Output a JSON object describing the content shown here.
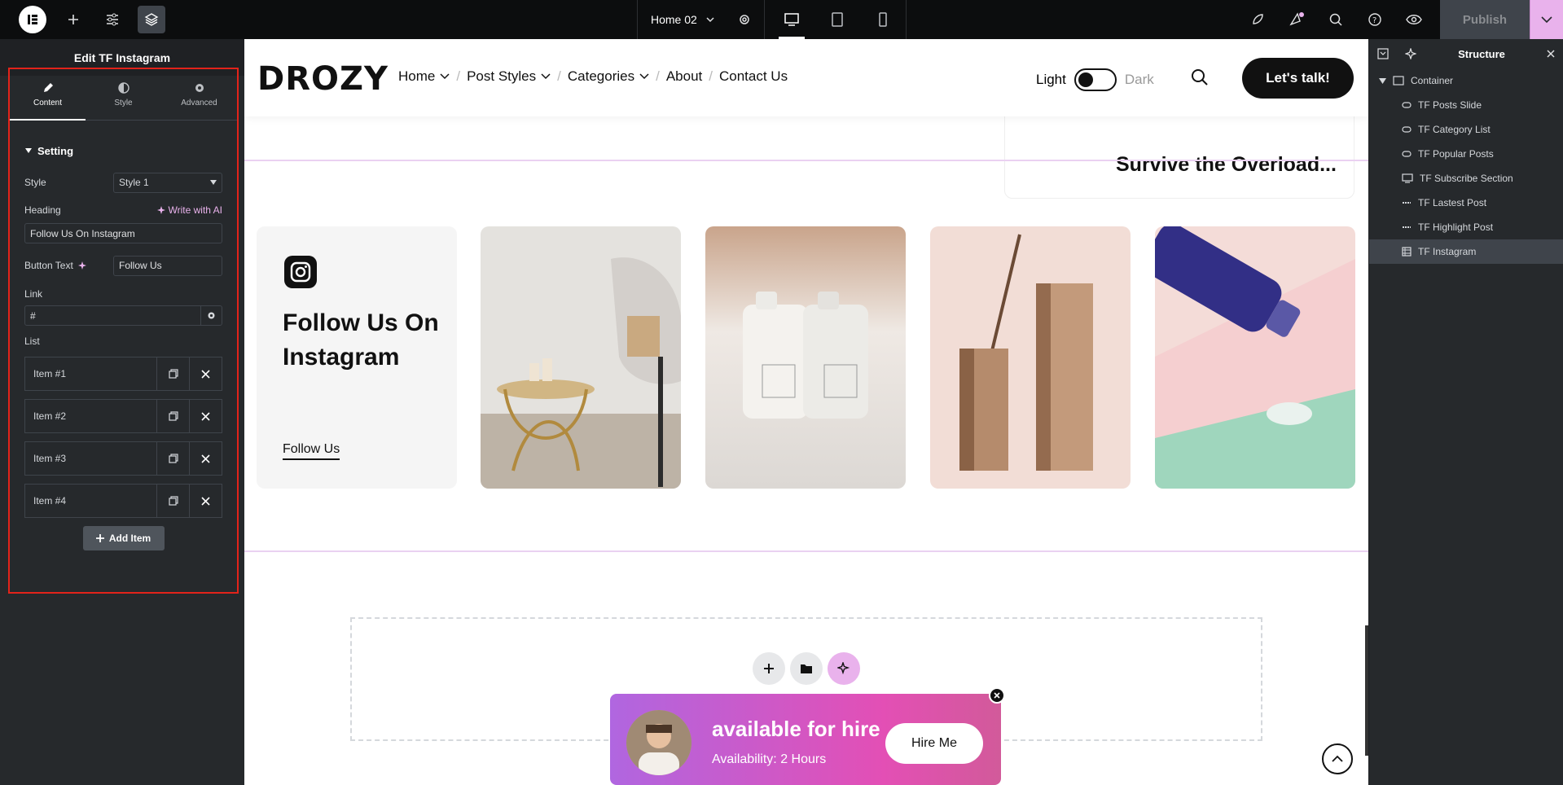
{
  "topbar": {
    "page_name": "Home 02",
    "publish_label": "Publish"
  },
  "panel": {
    "title": "Edit TF Instagram",
    "tabs": [
      {
        "label": "Content"
      },
      {
        "label": "Style"
      },
      {
        "label": "Advanced"
      }
    ],
    "section_title": "Setting",
    "style_label": "Style",
    "style_value": "Style 1",
    "heading_label": "Heading",
    "write_ai_label": "Write with AI",
    "heading_value": "Follow Us On Instagram",
    "button_text_label": "Button Text",
    "button_text_value": "Follow Us",
    "link_label": "Link",
    "link_value": "#",
    "list_label": "List",
    "list_items": [
      "Item #1",
      "Item #2",
      "Item #3",
      "Item #4"
    ],
    "add_item_label": "Add Item"
  },
  "site": {
    "brand": "DROZY",
    "nav": [
      "Home",
      "Post Styles",
      "Categories",
      "About",
      "Contact Us"
    ],
    "theme_light": "Light",
    "theme_dark": "Dark",
    "cta": "Let's talk!",
    "prev_post_title": "Survive the Overload...",
    "ig_heading": "Follow Us On Instagram",
    "ig_button": "Follow Us",
    "hire_title": "available for hire",
    "hire_availability": "Availability: 2 Hours",
    "hire_button": "Hire Me"
  },
  "structure": {
    "title": "Structure",
    "root": "Container",
    "items": [
      {
        "label": "TF Posts Slide"
      },
      {
        "label": "TF Category List"
      },
      {
        "label": "TF Popular Posts"
      },
      {
        "label": "TF Subscribe Section"
      },
      {
        "label": "TF Lastest Post"
      },
      {
        "label": "TF Highlight Post"
      },
      {
        "label": "TF Instagram"
      }
    ]
  }
}
